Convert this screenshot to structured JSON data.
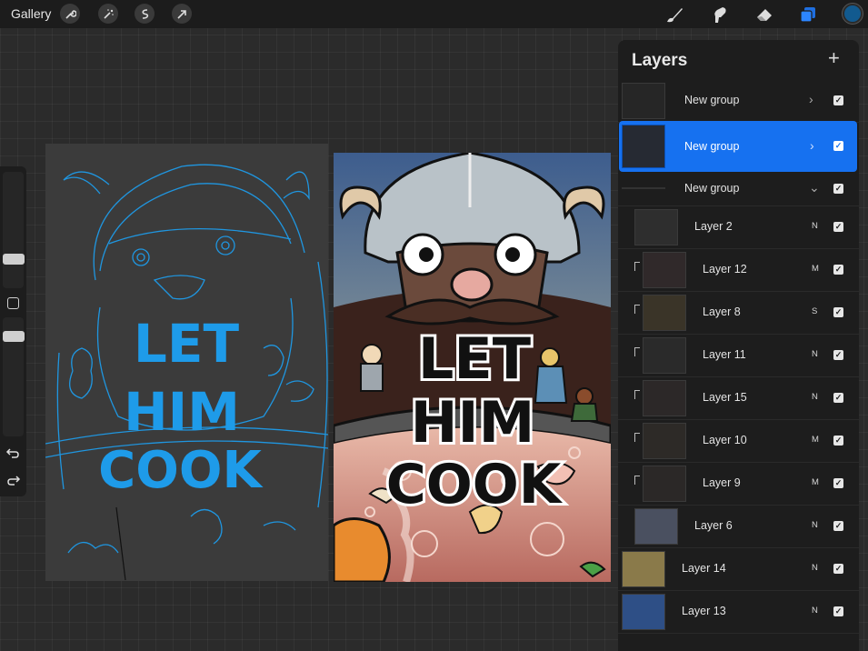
{
  "toolbar": {
    "gallery_label": "Gallery",
    "left_tools": [
      "wrench-icon",
      "magic-wand-icon",
      "selection-icon",
      "transform-arrow-icon"
    ],
    "right_tools": [
      "brush-icon",
      "smudge-icon",
      "eraser-icon",
      "layers-icon"
    ],
    "active_color": "#125a8f"
  },
  "sidebar": {
    "undo_icon": "undo-arrow-icon",
    "redo_icon": "redo-arrow-icon"
  },
  "sketch": {
    "lines": [
      "LET",
      "HIM",
      "COOK"
    ],
    "stroke_color": "#1e9be9"
  },
  "artwork": {
    "lines": [
      "LET",
      "HIM",
      "COOK"
    ]
  },
  "layers_panel": {
    "title": "Layers",
    "add_label": "+",
    "rows": [
      {
        "name": "New group",
        "mode": "",
        "type": "group",
        "expanded": false
      },
      {
        "name": "New group",
        "mode": "",
        "type": "group",
        "expanded": false,
        "selected": true
      },
      {
        "name": "New group",
        "mode": "",
        "type": "group",
        "expanded": true
      },
      {
        "name": "Layer 2",
        "mode": "N"
      },
      {
        "name": "Layer 12",
        "mode": "M",
        "clipped": true
      },
      {
        "name": "Layer 8",
        "mode": "S",
        "clipped": true
      },
      {
        "name": "Layer 11",
        "mode": "N",
        "clipped": true
      },
      {
        "name": "Layer 15",
        "mode": "N",
        "clipped": true
      },
      {
        "name": "Layer 10",
        "mode": "M",
        "clipped": true
      },
      {
        "name": "Layer 9",
        "mode": "M",
        "clipped": true
      },
      {
        "name": "Layer 6",
        "mode": "N"
      },
      {
        "name": "Layer 14",
        "mode": "N"
      },
      {
        "name": "Layer 13",
        "mode": "N"
      }
    ]
  },
  "colors": {
    "accent": "#1671f0",
    "panel": "#1d1d1d"
  }
}
